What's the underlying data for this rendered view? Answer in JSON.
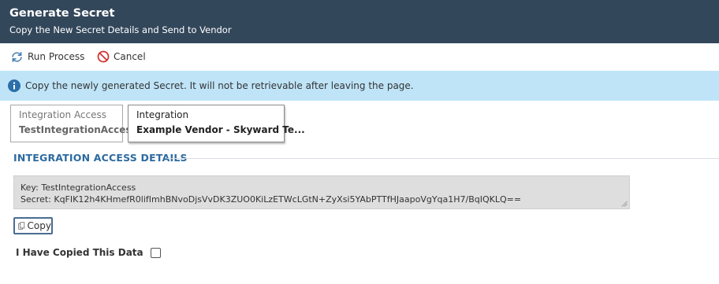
{
  "header": {
    "title": "Generate Secret",
    "subtitle": "Copy the New Secret Details and Send to Vendor"
  },
  "toolbar": {
    "run_label": "Run Process",
    "cancel_label": "Cancel"
  },
  "info": {
    "message": "Copy the newly generated Secret. It will not be retrievable after leaving the page."
  },
  "tabs": [
    {
      "label": "Integration Access",
      "value": "TestIntegrationAccess"
    },
    {
      "label": "Integration",
      "value": "Example Vendor - Skyward Te..."
    }
  ],
  "section": {
    "title": "INTEGRATION ACCESS DETAILS"
  },
  "details": {
    "key_line": "Key: TestIntegrationAccess",
    "secret_line": "Secret: KqFIK12h4KHmefR0lifImhBNvoDjsVvDK3ZUO0KiLzETWcLGtN+ZyXsi5YAbPTTfHJaapoVgYqa1H7/BqIQKLQ=="
  },
  "copy_label": "Copy",
  "confirm": {
    "label": "I Have Copied This Data",
    "checked": false
  },
  "colors": {
    "header_bg": "#33475b",
    "info_bg": "#bfe4f8",
    "info_icon": "#2a6fa8",
    "section_title": "#2d6a9f",
    "cancel_icon": "#d0312d"
  },
  "icons": {
    "run": "refresh-icon",
    "cancel": "cancel-icon",
    "info": "info-icon",
    "copy": "copy-icon"
  }
}
